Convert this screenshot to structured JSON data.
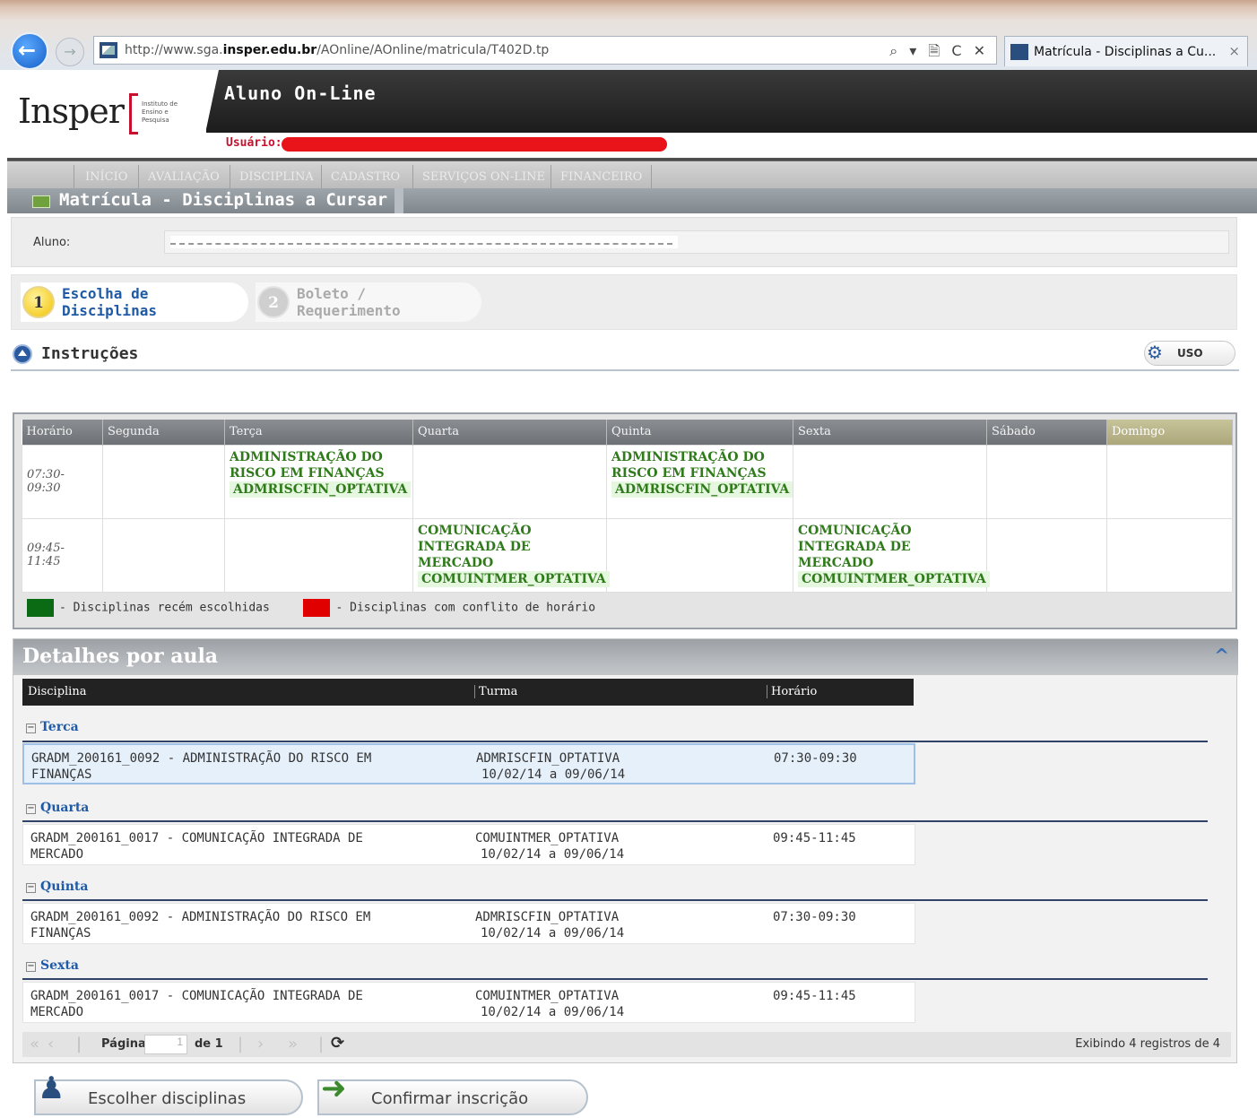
{
  "browser": {
    "url_prefix": "http://www.sga.",
    "url_domain": "insper.edu.br",
    "url_path": "/AOnline/AOnline/matricula/T402D.tp",
    "controls": "⌕ ▾ 🗎 C ✕",
    "tab_title": "Matrícula - Disciplinas a Cu...",
    "tab_close": "×"
  },
  "header": {
    "logo_text": "Insper",
    "logo_sub": "Instituto de Ensino e Pesquisa",
    "app_title": "Aluno On-Line",
    "user_label": "Usuário:"
  },
  "nav": [
    "INÍCIO",
    "AVALIAÇÃO",
    "DISCIPLINA",
    "CADASTRO",
    "SERVIÇOS ON-LINE",
    "FINANCEIRO"
  ],
  "page_heading": "Matrícula - Disciplinas a Cursar",
  "aluno": {
    "label": "Aluno:"
  },
  "steps": [
    {
      "num": "1",
      "line1": "Escolha de",
      "line2": "Disciplinas"
    },
    {
      "num": "2",
      "line1": "Boleto /",
      "line2": "Requerimento"
    }
  ],
  "instructions": {
    "title": "Instruções",
    "uso_label": "USO"
  },
  "schedule": {
    "headers": [
      "Horário",
      "Segunda",
      "Terça",
      "Quarta",
      "Quinta",
      "Sexta",
      "Sábado",
      "Domingo"
    ],
    "rows": [
      {
        "time_line1": "07:30-",
        "time_line2": "09:30",
        "terca": {
          "name_line1": "ADMINISTRAÇÃO DO",
          "name_line2": "RISCO EM FINANÇAS",
          "code": "ADMRISCFIN_OPTATIVA"
        },
        "quinta": {
          "name_line1": "ADMINISTRAÇÃO DO",
          "name_line2": "RISCO EM FINANÇAS",
          "code": "ADMRISCFIN_OPTATIVA"
        }
      },
      {
        "time_line1": "09:45-",
        "time_line2": "11:45",
        "quarta": {
          "name_line1": "COMUNICAÇÃO",
          "name_line2": "INTEGRADA DE MERCADO",
          "code": "COMUINTMER_OPTATIVA"
        },
        "sexta": {
          "name_line1": "COMUNICAÇÃO",
          "name_line2": "INTEGRADA DE MERCADO",
          "code": "COMUINTMER_OPTATIVA"
        }
      }
    ],
    "legend_new": "- Disciplinas recém escolhidas",
    "legend_conflict": "- Disciplinas com conflito de horário",
    "legend_new_color": "#0b6b14",
    "legend_conflict_color": "#e00000"
  },
  "details": {
    "title": "Detalhes por aula",
    "collapse_icon": "^",
    "columns": [
      "Disciplina",
      "Turma",
      "Horário"
    ],
    "groups": [
      {
        "day": "Terca",
        "disc_line1": "GRADM_200161_0092 - ADMINISTRAÇÃO DO RISCO EM",
        "disc_line2": "FINANÇAS",
        "turma": "ADMRISCFIN_OPTATIVA",
        "periodo": "10/02/14 a 09/06/14",
        "horario": "07:30-09:30"
      },
      {
        "day": "Quarta",
        "disc_line1": "GRADM_200161_0017 - COMUNICAÇÃO INTEGRADA DE",
        "disc_line2": "MERCADO",
        "turma": "COMUINTMER_OPTATIVA",
        "periodo": "10/02/14 a 09/06/14",
        "horario": "09:45-11:45"
      },
      {
        "day": "Quinta",
        "disc_line1": "GRADM_200161_0092 - ADMINISTRAÇÃO DO RISCO EM",
        "disc_line2": "FINANÇAS",
        "turma": "ADMRISCFIN_OPTATIVA",
        "periodo": "10/02/14 a 09/06/14",
        "horario": "07:30-09:30"
      },
      {
        "day": "Sexta",
        "disc_line1": "GRADM_200161_0017 - COMUNICAÇÃO INTEGRADA DE",
        "disc_line2": "MERCADO",
        "turma": "COMUINTMER_OPTATIVA",
        "periodo": "10/02/14 a 09/06/14",
        "horario": "09:45-11:45"
      }
    ],
    "pager": {
      "page_label": "Página",
      "page_value": "1",
      "of_label": "de 1",
      "info": "Exibindo 4 registros de 4"
    }
  },
  "buttons": {
    "choose": "Escolher disciplinas",
    "confirm": "Confirmar inscrição"
  }
}
